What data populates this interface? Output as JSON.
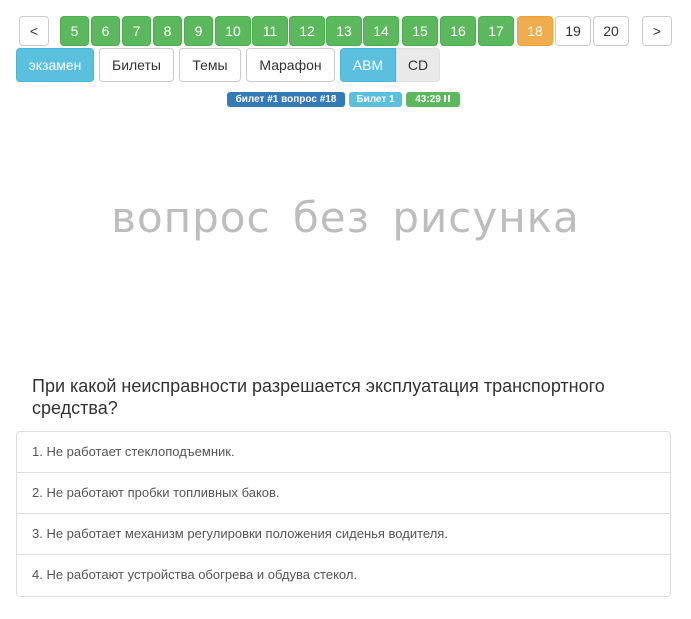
{
  "pagination": {
    "prev_label": "<",
    "next_label": ">",
    "items": [
      {
        "label": "5",
        "state": "answered"
      },
      {
        "label": "6",
        "state": "answered"
      },
      {
        "label": "7",
        "state": "answered"
      },
      {
        "label": "8",
        "state": "answered"
      },
      {
        "label": "9",
        "state": "answered"
      },
      {
        "label": "10",
        "state": "answered"
      },
      {
        "label": "11",
        "state": "answered"
      },
      {
        "label": "12",
        "state": "answered"
      },
      {
        "label": "13",
        "state": "answered"
      },
      {
        "label": "14",
        "state": "answered"
      },
      {
        "label": "15",
        "state": "answered"
      },
      {
        "label": "16",
        "state": "answered"
      },
      {
        "label": "17",
        "state": "answered"
      },
      {
        "label": "18",
        "state": "current"
      },
      {
        "label": "19",
        "state": "pending"
      },
      {
        "label": "20",
        "state": "pending"
      }
    ]
  },
  "modes": {
    "exam": "экзамен",
    "tickets": "Билеты",
    "topics": "Темы",
    "marathon": "Марафон",
    "category_abm": "ABM",
    "category_cd": "CD"
  },
  "status": {
    "ticket_question": "билет #1 вопрос #18",
    "ticket": "Билет 1",
    "timer": "43:29"
  },
  "image_placeholder": "вопрос без рисунка",
  "question": {
    "text": "При какой неисправности разрешается эксплуатация транспортного средства?",
    "answers": [
      "1. Не работает стеклоподъемник.",
      "2. Не работают пробки топливных баков.",
      "3. Не работает механизм регулировки положения сиденья водителя.",
      "4. Не работают устройства обогрева и обдува стекол."
    ]
  },
  "colors": {
    "answered": "#5cb85c",
    "current": "#f0ad4e",
    "primary": "#5bc0de",
    "badge_blue": "#337ab7"
  },
  "icons": {
    "pause": "pause-icon"
  }
}
